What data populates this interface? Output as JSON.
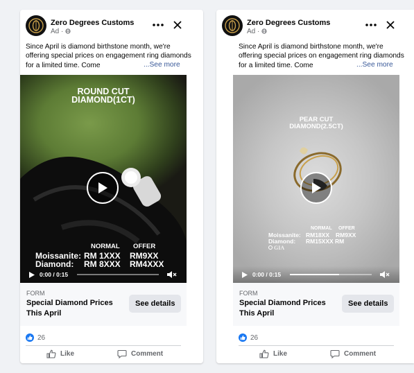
{
  "posts": [
    {
      "page_name": "Zero Degrees Customs",
      "ad_label": "Ad ·",
      "caption": "Since April is diamond birthstone month, we're offering special prices on engagement ring diamonds for a limited time. Come",
      "see_more": "...See more",
      "video": {
        "title_line1": "ROUND CUT",
        "title_line2": "DIAMOND(1CT)",
        "col_normal": "NORMAL",
        "col_offer": "OFFER",
        "row1_label": "Moissanite:",
        "row1_normal": "RM 1XXX",
        "row1_offer": "RM9XX",
        "row2_label": "Diamond:",
        "row2_normal": "RM 8XXX",
        "row2_offer": "RM4XXX",
        "time": "0:00 / 0:15",
        "progress": 0.0
      },
      "form_type": "FORM",
      "form_title": "Special Diamond Prices This April",
      "cta": "See details",
      "reaction_count": "26",
      "like_label": "Like",
      "comment_label": "Comment"
    },
    {
      "page_name": "Zero Degrees Customs",
      "ad_label": "Ad ·",
      "caption": "Since April is diamond birthstone month, we're offering special prices on engagement ring diamonds for a limited time. Come",
      "see_more": "...See more",
      "video": {
        "title_line1": "PEAR CUT",
        "title_line2": "DIAMOND(2.5CT)",
        "col_normal": "NORMAL",
        "col_offer": "OFFER",
        "row1_label": "Moissanite:",
        "row1_normal": "RM18XX",
        "row1_offer": "RM9XX",
        "row2_label": "Diamond:",
        "row2_normal": "RM15XXX RM",
        "gia": "GIA",
        "time": "0:00 / 0:15",
        "progress": 0.6
      },
      "form_type": "FORM",
      "form_title": "Special Diamond Prices This April",
      "cta": "See details",
      "reaction_count": "26",
      "like_label": "Like",
      "comment_label": "Comment"
    }
  ],
  "colors": {
    "accent_blue": "#1877f2",
    "link": "#385898",
    "secondary_text": "#65676b",
    "button_bg": "#e4e6eb"
  }
}
